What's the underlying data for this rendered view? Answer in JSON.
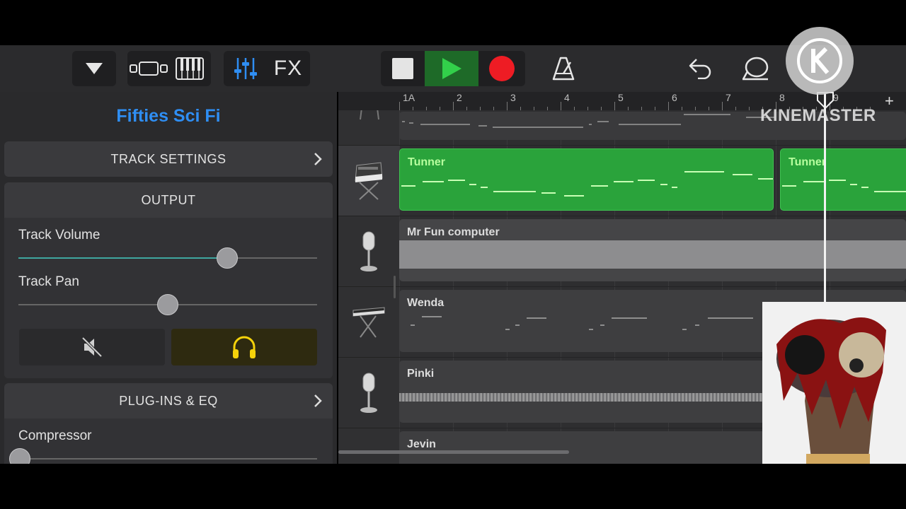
{
  "toolbar": {
    "fx_label": "FX"
  },
  "panel": {
    "track_name": "Fifties Sci Fi",
    "track_settings_label": "TRACK SETTINGS",
    "output_label": "OUTPUT",
    "track_volume_label": "Track Volume",
    "track_volume_value": 0.7,
    "track_pan_label": "Track Pan",
    "track_pan_value": 0.5,
    "plugins_label": "PLUG-INS & EQ",
    "compressor_label": "Compressor",
    "colors": {
      "accent": "#2f8ef3",
      "solo": "#f5d20a",
      "volume_fill": "#3fa7a0"
    }
  },
  "ruler": {
    "marks": [
      "1A",
      "2",
      "3",
      "4",
      "5",
      "6",
      "7",
      "8",
      "9"
    ],
    "add_label": "+"
  },
  "tracks": [
    {
      "name": "",
      "icon": "pedal-steel-icon"
    },
    {
      "name": "Tunner",
      "icon": "synth-keyboard-icon",
      "region_color": "#2aa33b",
      "selected": true
    },
    {
      "name": "Mr Fun computer",
      "icon": "microphone-icon",
      "region_color": "#8d8d8f"
    },
    {
      "name": "Wenda",
      "icon": "keyboard-stand-icon"
    },
    {
      "name": "Pinki",
      "icon": "microphone-icon"
    },
    {
      "name": "Jevin",
      "icon": "keyboard-icon"
    }
  ],
  "tunner_second_region": "Tunner",
  "watermark": "KINEMASTER"
}
